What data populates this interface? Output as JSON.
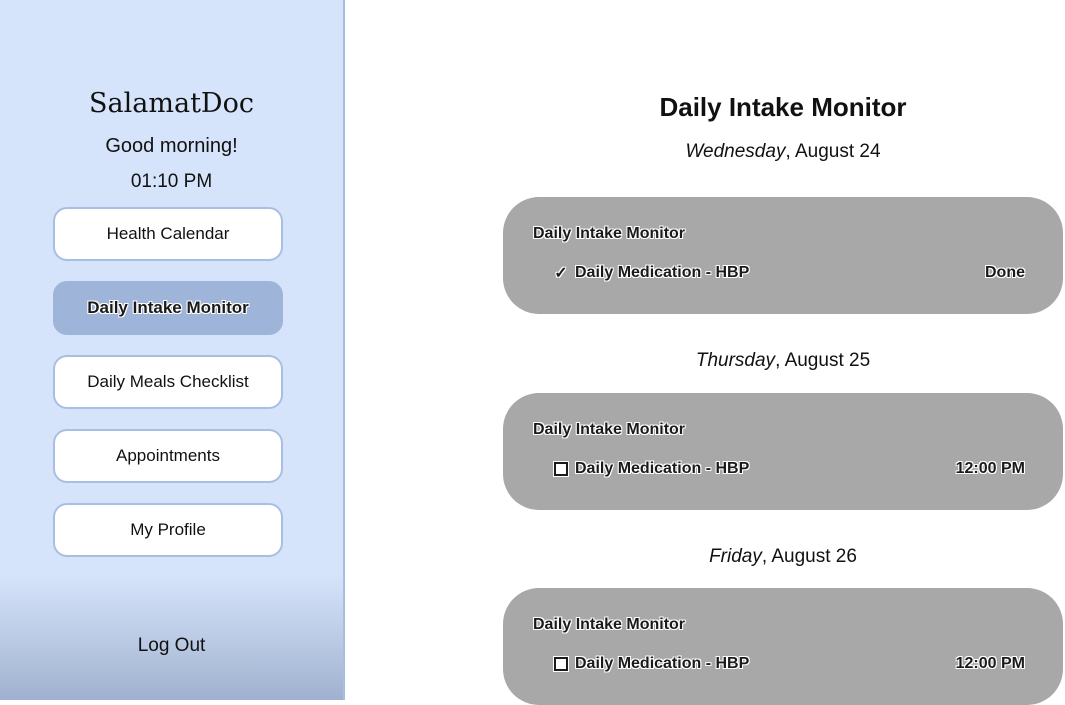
{
  "sidebar": {
    "brand": "SalamatDoc",
    "greeting": "Good morning!",
    "time": "01:10 PM",
    "nav": [
      {
        "label": "Health Calendar",
        "active": false
      },
      {
        "label": "Daily Intake Monitor",
        "active": true
      },
      {
        "label": "Daily Meals Checklist",
        "active": false
      },
      {
        "label": "Appointments",
        "active": false
      },
      {
        "label": "My Profile",
        "active": false
      }
    ],
    "logout": "Log Out"
  },
  "main": {
    "title": "Daily Intake Monitor",
    "days": [
      {
        "weekday": "Wednesday",
        "date": ", August 24",
        "card": {
          "title": "Daily Intake Monitor",
          "item": "Daily Medication - HBP",
          "done": true,
          "mark_icon": "check-icon",
          "mark_glyph": "✓",
          "status": "Done"
        }
      },
      {
        "weekday": "Thursday",
        "date": ", August 25",
        "card": {
          "title": "Daily Intake Monitor",
          "item": "Daily Medication - HBP",
          "done": false,
          "mark_icon": "checkbox-icon",
          "status": "12:00 PM"
        }
      },
      {
        "weekday": "Friday",
        "date": ", August 26",
        "card": {
          "title": "Daily Intake Monitor",
          "item": "Daily Medication - HBP",
          "done": false,
          "mark_icon": "checkbox-icon",
          "status": "12:00 PM"
        }
      }
    ]
  },
  "colors": {
    "sidebar_bg": "#d6e4fb",
    "sidebar_border": "#a9bfe2",
    "active_nav": "#9eb4d9",
    "card_bg": "#a8a8a8"
  }
}
